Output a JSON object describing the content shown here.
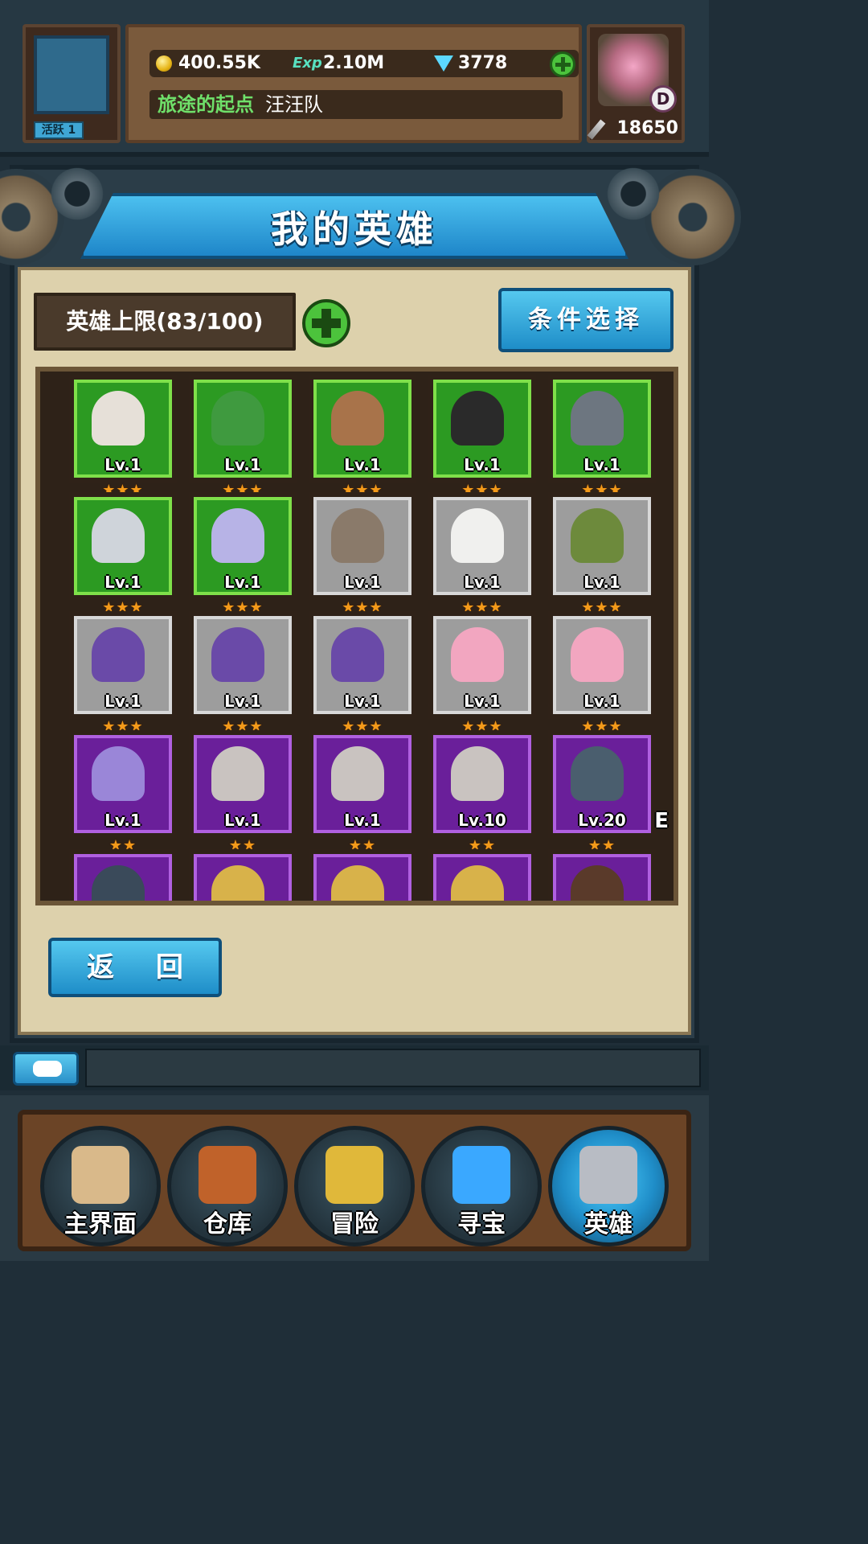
{
  "header": {
    "active_label": "活跃 1",
    "gold": "400.55K",
    "exp_label": "Exp",
    "exp": "2.10M",
    "gems": "3778",
    "stage_name": "旅途的起点",
    "team_name": "汪汪队",
    "rank_letter": "D",
    "power": "18650"
  },
  "page": {
    "title": "我的英雄",
    "hero_limit": "英雄上限(83/100)",
    "filter_button": "条件选择",
    "return_button": "返 回"
  },
  "heroes": [
    {
      "lv": "Lv.1",
      "stars": "★★★",
      "rarity": "green",
      "color": "#e6e0d8"
    },
    {
      "lv": "Lv.1",
      "stars": "★★★",
      "rarity": "green",
      "color": "#3f9a3f"
    },
    {
      "lv": "Lv.1",
      "stars": "★★★",
      "rarity": "green",
      "color": "#a8734a"
    },
    {
      "lv": "Lv.1",
      "stars": "★★★",
      "rarity": "green",
      "color": "#2a2a2a"
    },
    {
      "lv": "Lv.1",
      "stars": "★★★",
      "rarity": "green",
      "color": "#6d7680"
    },
    {
      "lv": "Lv.1",
      "stars": "★★★",
      "rarity": "green",
      "color": "#cfd4da"
    },
    {
      "lv": "Lv.1",
      "stars": "★★★",
      "rarity": "green",
      "color": "#b7b3e6"
    },
    {
      "lv": "Lv.1",
      "stars": "★★★",
      "rarity": "gray",
      "color": "#8a7a6a"
    },
    {
      "lv": "Lv.1",
      "stars": "★★★",
      "rarity": "gray",
      "color": "#f0f0ee"
    },
    {
      "lv": "Lv.1",
      "stars": "★★★",
      "rarity": "gray",
      "color": "#6d8a3c"
    },
    {
      "lv": "Lv.1",
      "stars": "★★★",
      "rarity": "gray",
      "color": "#6a4aa8"
    },
    {
      "lv": "Lv.1",
      "stars": "★★★",
      "rarity": "gray",
      "color": "#6a4aa8"
    },
    {
      "lv": "Lv.1",
      "stars": "★★★",
      "rarity": "gray",
      "color": "#6a4aa8"
    },
    {
      "lv": "Lv.1",
      "stars": "★★★",
      "rarity": "gray",
      "color": "#f2a6c0"
    },
    {
      "lv": "Lv.1",
      "stars": "★★★",
      "rarity": "gray",
      "color": "#f2a6c0"
    },
    {
      "lv": "Lv.1",
      "stars": "★★",
      "rarity": "purple",
      "color": "#9a86d8"
    },
    {
      "lv": "Lv.1",
      "stars": "★★",
      "rarity": "purple",
      "color": "#c9c3c0"
    },
    {
      "lv": "Lv.1",
      "stars": "★★",
      "rarity": "purple",
      "color": "#c9c3c0"
    },
    {
      "lv": "Lv.10",
      "stars": "★★",
      "rarity": "purple",
      "color": "#c9c3c0"
    },
    {
      "lv": "Lv.20",
      "stars": "★★",
      "rarity": "purple",
      "color": "#4a5e6e",
      "equip": "E"
    },
    {
      "lv": "",
      "stars": "",
      "rarity": "purple",
      "color": "#3a4a5a"
    },
    {
      "lv": "",
      "stars": "",
      "rarity": "purple",
      "color": "#d8b24a"
    },
    {
      "lv": "",
      "stars": "",
      "rarity": "purple",
      "color": "#d8b24a"
    },
    {
      "lv": "",
      "stars": "",
      "rarity": "purple",
      "color": "#d8b24a"
    },
    {
      "lv": "",
      "stars": "",
      "rarity": "purple",
      "color": "#5a3a2a"
    }
  ],
  "nav": {
    "items": [
      {
        "label": "主界面",
        "icon": "scroll-map-icon",
        "color": "#d9b98a"
      },
      {
        "label": "仓库",
        "icon": "backpack-icon",
        "color": "#c0622a"
      },
      {
        "label": "冒险",
        "icon": "crossed-swords-icon",
        "color": "#e0b83a"
      },
      {
        "label": "寻宝",
        "icon": "crystal-icon",
        "color": "#3aa8ff"
      },
      {
        "label": "英雄",
        "icon": "knight-helmet-icon",
        "color": "#b8bcc4",
        "active": true
      }
    ]
  }
}
